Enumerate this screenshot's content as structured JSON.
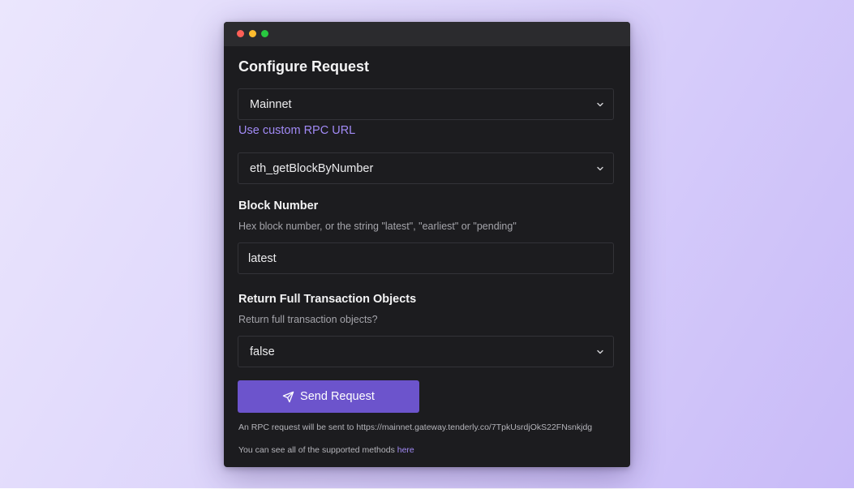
{
  "window": {
    "title_dots": [
      "close",
      "minimize",
      "zoom"
    ]
  },
  "form": {
    "heading": "Configure Request",
    "network_select": {
      "value": "Mainnet"
    },
    "custom_rpc_link": "Use custom RPC URL",
    "method_select": {
      "value": "eth_getBlockByNumber"
    },
    "block_number": {
      "label": "Block Number",
      "help": "Hex block number, or the string \"latest\", \"earliest\" or \"pending\"",
      "value": "latest"
    },
    "full_tx": {
      "label": "Return Full Transaction Objects",
      "help": "Return full transaction objects?",
      "value": "false"
    },
    "send_button": {
      "label": "Send Request",
      "icon": "send-icon"
    },
    "rpc_note": "An RPC request will be sent to https://mainnet.gateway.tenderly.co/7TpkUsrdjOkS22FNsnkjdg",
    "methods_note": {
      "prefix": "You can see all of the supported methods ",
      "link": "here"
    }
  },
  "colors": {
    "accent": "#6c54cc",
    "link": "#a18af5",
    "panel": "#1c1c1f",
    "titlebar": "#2b2b2e"
  }
}
